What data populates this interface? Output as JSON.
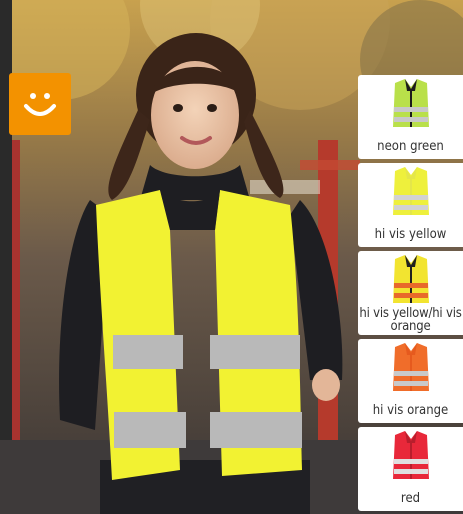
{
  "swatches": [
    {
      "label": "neon green",
      "body": "#b9e04a",
      "trim": "#1c1c1c",
      "stripe": "#c8c8c8",
      "two_line": false
    },
    {
      "label": "hi vis yellow",
      "body": "#eef03c",
      "trim": "#e4e64a",
      "stripe": "#d2d2d2",
      "two_line": false
    },
    {
      "label": "hi vis yellow/hi vis orange",
      "body": "#f2e430",
      "trim": "#202020",
      "stripe": "#e86a2a",
      "two_line": true
    },
    {
      "label": "hi vis orange",
      "body": "#f06d2a",
      "trim": "#e65a1e",
      "stripe": "#c9c9c9",
      "two_line": false
    },
    {
      "label": "red",
      "body": "#e8283a",
      "trim": "#b81e2c",
      "stripe": "#e0e0e0",
      "two_line": false
    }
  ],
  "colors": {
    "badge": "#f39200",
    "vest": "#f2f232"
  },
  "icons": {
    "badge": "smiley-face-icon"
  }
}
